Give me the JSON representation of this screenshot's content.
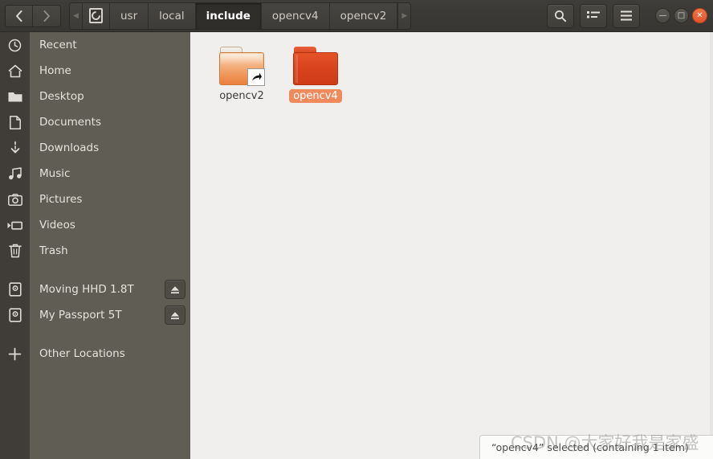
{
  "window": {
    "title": "include",
    "controls": [
      {
        "name": "minimize",
        "glyph": "—"
      },
      {
        "name": "maximize",
        "glyph": "□"
      },
      {
        "name": "close",
        "glyph": "✕"
      }
    ]
  },
  "nav": {
    "back_label": "‹",
    "forward_label": "›",
    "scroll_left": "◀",
    "scroll_right": "▶"
  },
  "breadcrumb": {
    "root_icon": "filesystem-icon",
    "items": [
      {
        "label": "usr",
        "current": false
      },
      {
        "label": "local",
        "current": false
      },
      {
        "label": "include",
        "current": true
      },
      {
        "label": "opencv4",
        "current": false
      },
      {
        "label": "opencv2",
        "current": false
      }
    ]
  },
  "toolbar": {
    "search_label": "search-icon",
    "view_toggle_label": "list-view-icon",
    "menu_label": "hamburger-menu-icon"
  },
  "sidebar": {
    "items": [
      {
        "label": "Recent",
        "icon": "clock-icon",
        "eject": false
      },
      {
        "label": "Home",
        "icon": "home-icon",
        "eject": false
      },
      {
        "label": "Desktop",
        "icon": "folder-icon",
        "eject": false
      },
      {
        "label": "Documents",
        "icon": "document-icon",
        "eject": false
      },
      {
        "label": "Downloads",
        "icon": "download-icon",
        "eject": false
      },
      {
        "label": "Music",
        "icon": "music-icon",
        "eject": false
      },
      {
        "label": "Pictures",
        "icon": "camera-icon",
        "eject": false
      },
      {
        "label": "Videos",
        "icon": "video-icon",
        "eject": false
      },
      {
        "label": "Trash",
        "icon": "trash-icon",
        "eject": false
      }
    ],
    "devices": [
      {
        "label": "Moving HHD 1.8T",
        "icon": "drive-icon",
        "eject": true
      },
      {
        "label": "My Passport 5T",
        "icon": "drive-icon",
        "eject": true
      }
    ],
    "other": {
      "label": "Other Locations",
      "icon": "plus-icon"
    },
    "eject_glyph": "⏏"
  },
  "files": [
    {
      "name": "opencv2",
      "type": "folder-symlink",
      "selected": false
    },
    {
      "name": "opencv4",
      "type": "folder",
      "selected": true
    }
  ],
  "statusbar": {
    "text": "“opencv4” selected (containing 1 item)"
  },
  "watermark": {
    "text": "CSDN @大家好我是家盛"
  },
  "colors": {
    "headerbar": "#3b3935",
    "sidebar": "#605d54",
    "icon_strip": "#403d38",
    "content": "#f0efee",
    "selection": "#ef8a5c",
    "close_button": "#e3552a"
  }
}
